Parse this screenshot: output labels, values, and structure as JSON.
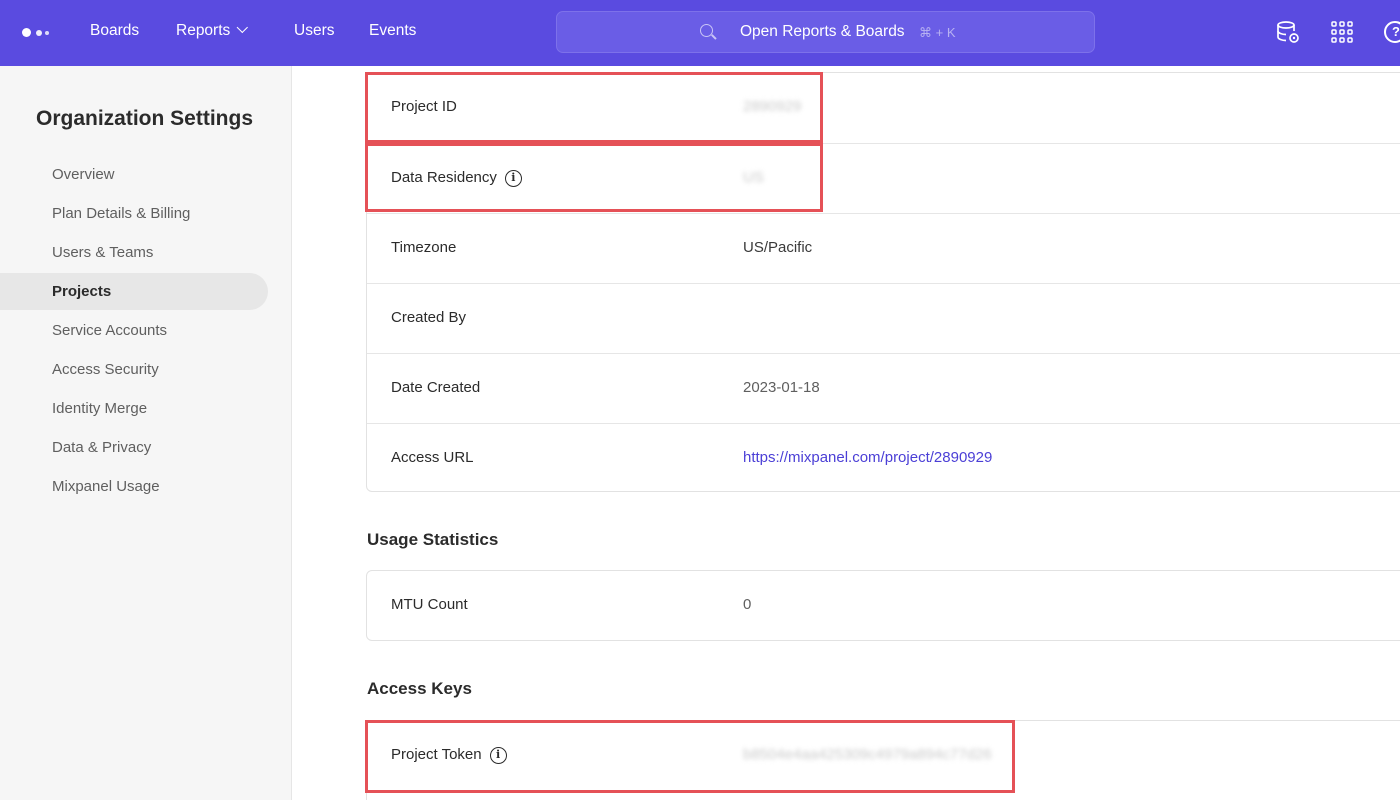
{
  "topbar": {
    "nav": [
      "Boards",
      "Reports",
      "Users",
      "Events"
    ],
    "search_placeholder": "Open Reports & Boards",
    "search_shortcut": "⌘ + K",
    "help_glyph": "?"
  },
  "sidebar": {
    "title": "Organization Settings",
    "items": [
      {
        "label": "Overview"
      },
      {
        "label": "Plan Details & Billing"
      },
      {
        "label": "Users & Teams"
      },
      {
        "label": "Projects",
        "active": true
      },
      {
        "label": "Service Accounts"
      },
      {
        "label": "Access Security"
      },
      {
        "label": "Identity Merge"
      },
      {
        "label": "Data & Privacy"
      },
      {
        "label": "Mixpanel Usage"
      }
    ]
  },
  "project_details": {
    "rows": [
      {
        "label": "Project ID",
        "value": "2890929"
      },
      {
        "label": "Data Residency",
        "value": "US"
      },
      {
        "label": "Timezone",
        "value": "US/Pacific"
      },
      {
        "label": "Created By",
        "value": ""
      },
      {
        "label": "Date Created",
        "value": "2023-01-18"
      },
      {
        "label": "Access URL",
        "value": "https://mixpanel.com/project/2890929"
      }
    ]
  },
  "usage_statistics": {
    "title": "Usage Statistics",
    "rows": [
      {
        "label": "MTU Count",
        "value": "0"
      }
    ]
  },
  "access_keys": {
    "title": "Access Keys",
    "rows": [
      {
        "label": "Project Token",
        "value": "b8504e4aa425309c4979a894c77d26"
      }
    ]
  },
  "colors": {
    "topbar": "#5a4be0",
    "highlight": "#e55157",
    "link": "#4b3fd6"
  },
  "icons": [
    "mixpanel-logo-icon",
    "chevron-down-icon",
    "search-icon",
    "database-settings-icon",
    "apps-grid-icon",
    "help-icon",
    "info-icon"
  ]
}
